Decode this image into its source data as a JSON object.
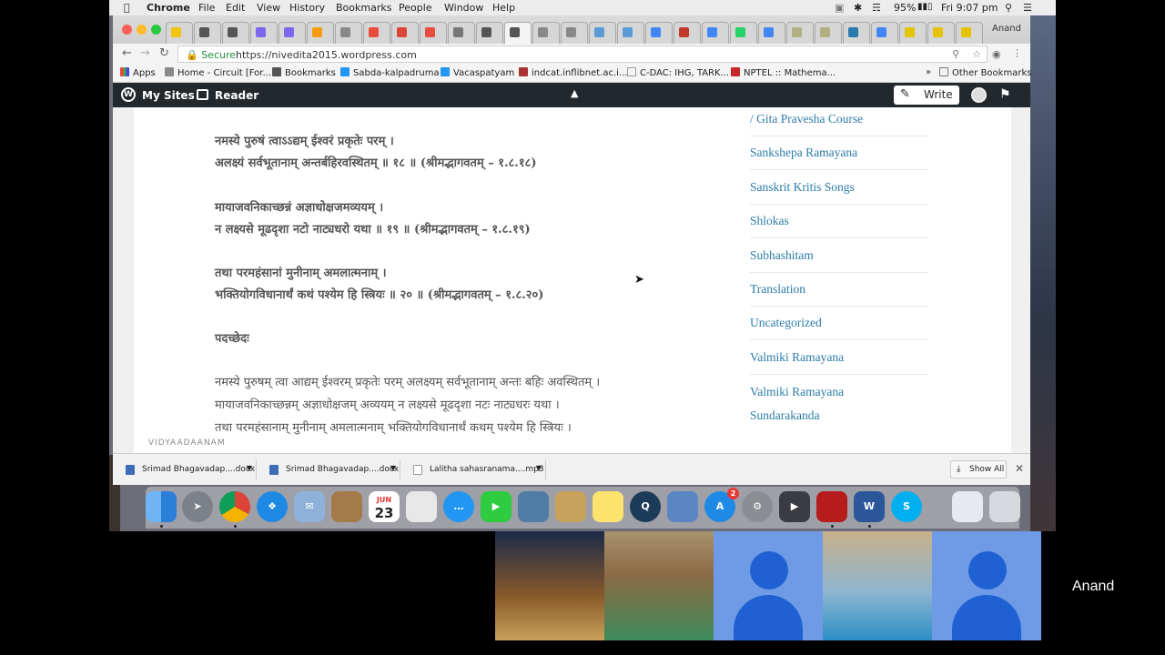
{
  "menubar": {
    "app": "Chrome",
    "items": [
      "File",
      "Edit",
      "View",
      "History",
      "Bookmarks",
      "People",
      "Window",
      "Help"
    ],
    "battery": "95%",
    "clock": "Fri 9:07 pm"
  },
  "browser": {
    "profile_name": "Anand",
    "secure_label": "Secure",
    "url": "https://nivedita2015.wordpress.com",
    "bookmarks": [
      "Apps",
      "Home - Circuit [For...",
      "Bookmarks",
      "Sabda-kalpadruma",
      "Vacaspatyam",
      "indcat.inflibnet.ac.i...",
      "C-DAC: IHG, TARK...",
      "NPTEL :: Mathema...",
      "Other Bookmarks"
    ]
  },
  "wp_bar": {
    "my_sites": "My Sites",
    "reader": "Reader",
    "write": "Write"
  },
  "article": {
    "verses": [
      "नमस्ये पुरुषं त्वाऽऽद्यम् ईश्वरं प्रकृतेः परम् ।",
      "अलक्ष्यं सर्वभूतानाम् अन्तर्बहिरवस्थितम् ॥ १८ ॥ (श्रीमद्भागवतम् – १.८.१८)",
      "मायाजवनिकाच्छन्नं अज्ञाधोक्षजमव्ययम् ।",
      "न लक्ष्यसे मूढदृशा नटो नाट्यधरो यथा ॥ १९ ॥ (श्रीमद्भागवतम् – १.८.१९)",
      "तथा परमहंसानां मुनीनाम् अमलात्मनाम् ।",
      "भक्तियोगविधानार्थं कथं पश्येम हि स्त्रियः ॥ २० ॥ (श्रीमद्भागवतम् – १.८.२०)"
    ],
    "padaccheda_heading": "पदच्छेदः",
    "padaccheda": [
      "नमस्ये पुरुषम् त्वा आद्यम् ईश्वरम् प्रकृतेः परम् अलक्ष्यम् सर्वभूतानाम् अन्तः बहिः अवस्थितम् ।",
      "मायाजवनिकाच्छन्नम् अज्ञाधोक्षजम् अव्ययम्  न लक्ष्यसे मूढदृशा नटः नाट्यधरः यथा ।",
      "तथा परमहंसानाम् मुनीनाम् अमलात्मनाम् भक्तियोगविधानार्थं कथम् पश्येम हि स्त्रियः ।"
    ],
    "footer_brand": "VIDYAADAANAM"
  },
  "sidebar": {
    "categories": [
      "/ Gita Pravesha Course",
      "Sankshepa Ramayana",
      "Sanskrit Kritis Songs",
      "Shlokas",
      "Subhashitam",
      "Translation",
      "Uncategorized",
      "Valmiki Ramayana",
      "Valmiki Ramayana",
      "Sundarakanda"
    ]
  },
  "downloads": {
    "items": [
      "Srimad Bhagavadap....docx",
      "Srimad Bhagavadap....docx",
      "Lalitha sahasranama....mp3"
    ],
    "show_all": "Show All"
  },
  "dock": {
    "calendar_month": "JUN",
    "calendar_day": "23",
    "appstore_badge": "2"
  },
  "call": {
    "speaker_name": "Anand"
  },
  "colors": {
    "wp_bar": "#23282d",
    "link": "#2b7ca8",
    "avatar_bg": "#6f9be6",
    "avatar_fg": "#1f61d2"
  }
}
